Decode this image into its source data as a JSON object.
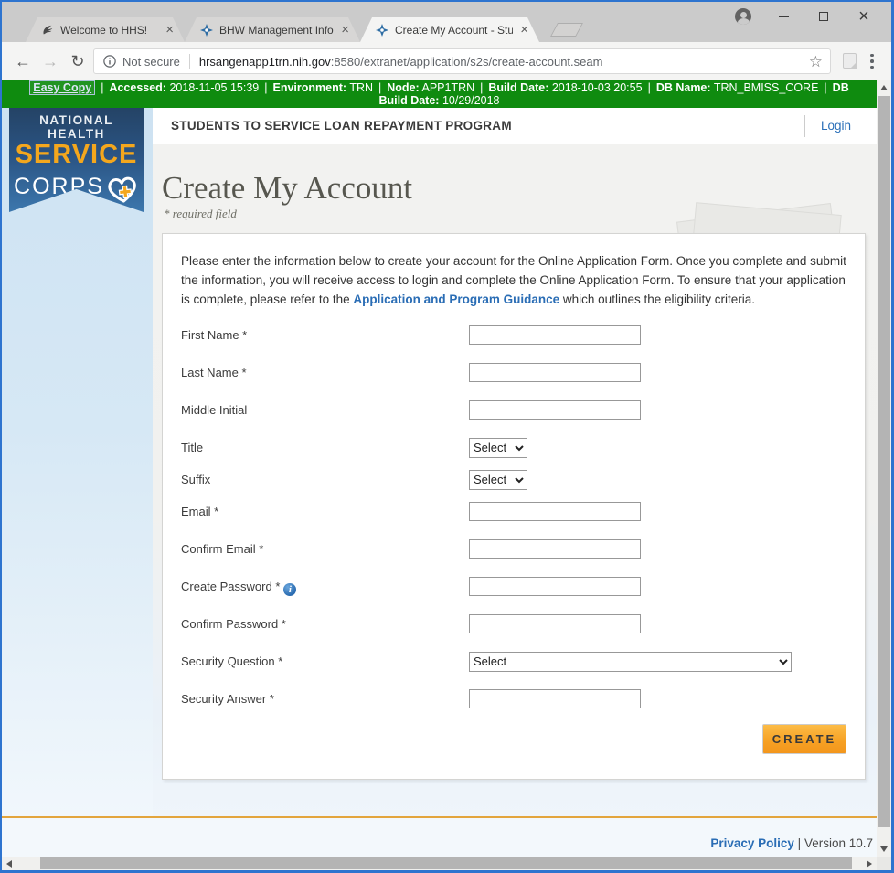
{
  "browser": {
    "tabs": [
      {
        "title": "Welcome to HHS!",
        "icon": "hhs-favicon-icon"
      },
      {
        "title": "BHW Management Inform",
        "icon": "bhw-compass-icon"
      },
      {
        "title": "Create My Account - Stud",
        "icon": "bhw-compass-icon"
      }
    ],
    "close_glyph": "×",
    "nav": {
      "back": "←",
      "forward": "→",
      "reload": "↻"
    },
    "address_bar": {
      "security_label": "Not secure",
      "url_host": "hrsangenapp1trn.nih.gov",
      "url_path": ":8580/extranet/application/s2s/create-account.seam",
      "star_glyph": "☆"
    }
  },
  "env_banner": {
    "link": "Easy Copy",
    "separator": "|",
    "line1": [
      {
        "label": "Accessed:",
        "value": "2018-11-05 15:39"
      },
      {
        "label": "Environment:",
        "value": "TRN"
      },
      {
        "label": "Node:",
        "value": "APP1TRN"
      },
      {
        "label": "Build Date:",
        "value": "2018-10-03 20:55"
      },
      {
        "label": "DB Name:",
        "value": "TRN_BMISS_CORE"
      },
      {
        "label": "DB",
        "value": ""
      }
    ],
    "line2": {
      "label": "Build Date:",
      "value": "10/29/2018"
    }
  },
  "logo": {
    "line1": "NATIONAL HEALTH",
    "line2": "SERVICE",
    "line3": "CORPS"
  },
  "header": {
    "program_title": "STUDENTS TO SERVICE LOAN REPAYMENT PROGRAM",
    "login_label": "Login"
  },
  "page": {
    "title": "Create My Account",
    "required_note": "* required field"
  },
  "form": {
    "intro_before": "Please enter the information below to create your account for the Online Application Form. Once you complete and submit the information, you will receive access to login and complete the Online Application Form. To ensure that your application is complete, please refer to the ",
    "intro_link": "Application and Program Guidance",
    "intro_after": " which outlines the eligibility criteria.",
    "info_glyph": "i",
    "fields": [
      {
        "name": "first-name",
        "label": "First Name *",
        "type": "text"
      },
      {
        "name": "last-name",
        "label": "Last Name *",
        "type": "text"
      },
      {
        "name": "middle-initial",
        "label": "Middle Initial",
        "type": "text"
      },
      {
        "name": "title",
        "label": "Title",
        "type": "select-small",
        "value": "Select"
      },
      {
        "name": "suffix",
        "label": "Suffix",
        "type": "select-small",
        "value": "Select"
      },
      {
        "name": "email",
        "label": "Email *",
        "type": "text"
      },
      {
        "name": "confirm-email",
        "label": "Confirm Email *",
        "type": "text"
      },
      {
        "name": "create-password",
        "label": "Create Password *",
        "type": "text",
        "info_icon": true
      },
      {
        "name": "confirm-password",
        "label": "Confirm Password *",
        "type": "text"
      },
      {
        "name": "security-question",
        "label": "Security Question *",
        "type": "select-wide",
        "value": "Select"
      },
      {
        "name": "security-answer",
        "label": "Security Answer *",
        "type": "text"
      }
    ],
    "submit_label": "CREATE"
  },
  "footer": {
    "privacy_link": "Privacy Policy",
    "separator": " | ",
    "version": "Version 10.7"
  },
  "colors": {
    "banner_green": "#0f8b0f",
    "button_orange": "#f6a023",
    "logo_navy": "#223d5b",
    "logo_gold": "#f4a71d",
    "link_blue": "#2a6db5",
    "rule_orange": "#e3a53d"
  }
}
